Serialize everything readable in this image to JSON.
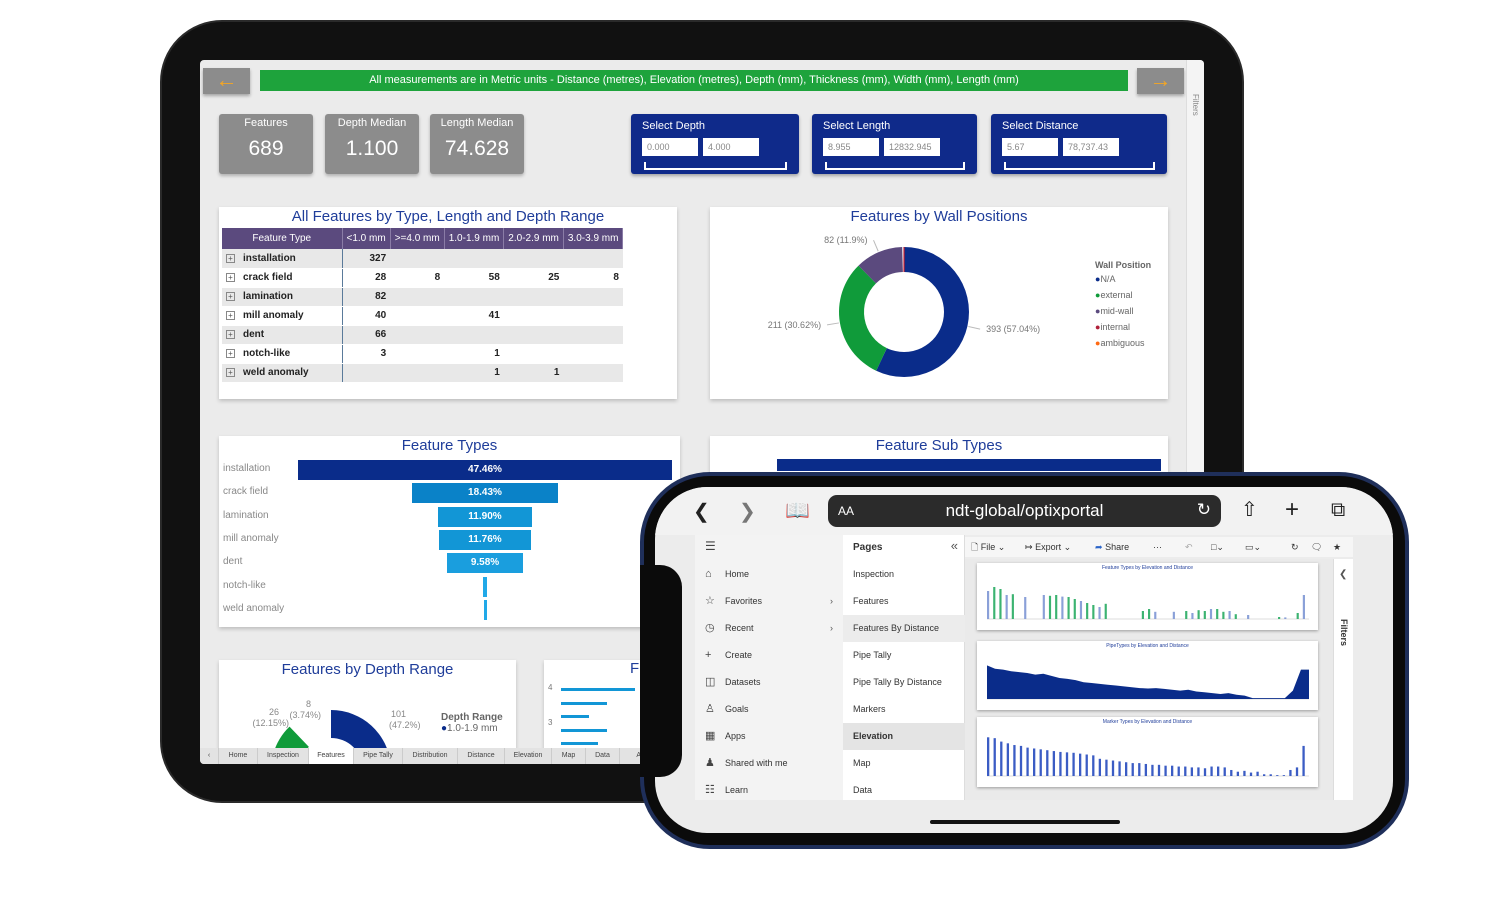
{
  "tablet": {
    "banner": "All measurements are in Metric units - Distance (metres), Elevation (metres), Depth (mm), Thickness (mm), Width (mm), Length (mm)",
    "back_icon": "arrow-left",
    "forward_icon": "arrow-right",
    "accent": "#f5a623",
    "filters_label": "Filters",
    "kpis": [
      {
        "label": "Features",
        "value": "689"
      },
      {
        "label": "Depth Median",
        "value": "1.100"
      },
      {
        "label": "Length Median",
        "value": "74.628"
      }
    ],
    "slicers": [
      {
        "label": "Select Depth",
        "min": "0.000",
        "max": "4.000"
      },
      {
        "label": "Select Length",
        "min": "8.955",
        "max": "12832.945"
      },
      {
        "label": "Select Distance",
        "min": "5.67",
        "max": "78,737.43"
      }
    ],
    "table": {
      "title": "All Features by Type, Length and Depth Range",
      "headers": [
        "Feature Type",
        "<1.0 mm",
        ">=4.0 mm",
        "1.0-1.9 mm",
        "2.0-2.9 mm",
        "3.0-3.9 mm"
      ],
      "rows": [
        [
          "installation",
          "327",
          "",
          "",
          "",
          ""
        ],
        [
          "crack field",
          "28",
          "8",
          "58",
          "25",
          "8"
        ],
        [
          "lamination",
          "82",
          "",
          "",
          "",
          ""
        ],
        [
          "mill anomaly",
          "40",
          "",
          "41",
          "",
          ""
        ],
        [
          "dent",
          "66",
          "",
          "",
          "",
          ""
        ],
        [
          "notch-like",
          "3",
          "",
          "1",
          "",
          ""
        ],
        [
          "weld anomaly",
          "",
          "",
          "1",
          "1",
          ""
        ]
      ]
    },
    "feature_subtypes_title": "Feature Sub Types",
    "small_card": {
      "title": "F",
      "ticks": [
        "4",
        "3"
      ]
    },
    "tabs": [
      "Home",
      "Inspection",
      "Features",
      "Pipe Tally",
      "Distribution",
      "Distance",
      "Elevation",
      "Map",
      "Data",
      "Al"
    ],
    "active_tab": "Features"
  },
  "chart_data": [
    {
      "type": "pie",
      "title": "Features by Wall Positions",
      "legend_title": "Wall Position",
      "legend_position": "right",
      "slices": [
        {
          "name": "N/A",
          "value": 393,
          "label": "393 (57.04%)",
          "pct": 57.04,
          "color": "#0a2c8a"
        },
        {
          "name": "external",
          "value": 211,
          "label": "211 (30.62%)",
          "pct": 30.62,
          "color": "#109b3a"
        },
        {
          "name": "mid-wall",
          "value": 82,
          "label": "82 (11.9%)",
          "pct": 11.9,
          "color": "#5b4a7e"
        },
        {
          "name": "internal",
          "color": "#b0203a"
        },
        {
          "name": "ambiguous",
          "color": "#ff6a13"
        }
      ]
    },
    {
      "type": "bar",
      "title": "Feature Types",
      "orientation": "funnel",
      "categories": [
        "installation",
        "crack field",
        "lamination",
        "mill anomaly",
        "dent",
        "notch-like",
        "weld anomaly"
      ],
      "values": [
        47.46,
        18.43,
        11.9,
        11.76,
        9.58,
        0.58,
        0.29
      ],
      "labels": [
        "47.46%",
        "18.43%",
        "11.90%",
        "11.76%",
        "9.58%",
        "",
        ""
      ],
      "colors": [
        "#0a2c8a",
        "#0a82c8",
        "#1296d6",
        "#1296d6",
        "#1a9ede",
        "#21a9e8",
        "#21a9e8"
      ]
    },
    {
      "type": "pie",
      "title": "Features by Depth Range",
      "legend_title": "Depth Range",
      "legend_entries": [
        "1.0-1.9 mm"
      ],
      "slices": [
        {
          "value": 101,
          "label": "101",
          "pct_label": "(47.2%)",
          "pct": 47.2,
          "color": "#0a2c8a"
        },
        {
          "value": 8,
          "label": "8",
          "pct_label": "(3.74%)",
          "pct": 3.74,
          "color": "#b0203a"
        },
        {
          "color": "#ff6a13"
        },
        {
          "value": 26,
          "label": "26",
          "pct_label": "(12.15%)",
          "pct": 12.15,
          "color": "#109b3a"
        }
      ]
    }
  ],
  "phone": {
    "url": "ndt-global/optixportal",
    "aa": "AA",
    "nav": [
      {
        "label": "Home",
        "icon": "home"
      },
      {
        "label": "Favorites",
        "icon": "star",
        "chev": true
      },
      {
        "label": "Recent",
        "icon": "clock",
        "chev": true
      },
      {
        "label": "Create",
        "icon": "plus"
      },
      {
        "label": "Datasets",
        "icon": "database"
      },
      {
        "label": "Goals",
        "icon": "trophy"
      },
      {
        "label": "Apps",
        "icon": "apps"
      },
      {
        "label": "Shared with me",
        "icon": "shared"
      },
      {
        "label": "Learn",
        "icon": "book"
      }
    ],
    "pages_title": "Pages",
    "pages": [
      "Inspection",
      "Features",
      "Features By Distance",
      "Pipe Tally",
      "Pipe Tally By Distance",
      "Markers",
      "Elevation",
      "Map",
      "Data"
    ],
    "highlighted_page": "Features By Distance",
    "selected_page": "Elevation",
    "toolbar": {
      "file": "File",
      "export": "Export",
      "share": "Share",
      "more": "···"
    },
    "filters_label": "Filters",
    "mini_charts": [
      {
        "title": "Feature Types by Elevation and Distance",
        "type": "bar",
        "color": "#3cb371",
        "values": [
          70,
          80,
          75,
          60,
          62,
          0,
          55,
          0,
          0,
          60,
          58,
          60,
          56,
          55,
          50,
          45,
          40,
          35,
          30,
          38,
          0,
          0,
          0,
          0,
          0,
          20,
          25,
          18,
          0,
          0,
          18,
          0,
          20,
          15,
          22,
          20,
          25,
          25,
          18,
          20,
          12,
          0,
          10,
          0,
          0,
          0,
          0,
          5,
          4,
          0,
          15,
          60
        ]
      },
      {
        "title": "PipeTypes by Elevation and Distance",
        "type": "area",
        "color": "#0a2c8a",
        "values": [
          80,
          72,
          70,
          66,
          64,
          62,
          58,
          60,
          55,
          50,
          48,
          45,
          40,
          38,
          36,
          34,
          32,
          30,
          28,
          26,
          25,
          26,
          24,
          22,
          20,
          22,
          18,
          16,
          14,
          12,
          14,
          10,
          8,
          2,
          2,
          2,
          2,
          2,
          20,
          70
        ]
      },
      {
        "title": "Marker Types by Elevation and Distance",
        "type": "bar",
        "color": "#3b5cc4",
        "values": [
          90,
          88,
          80,
          76,
          72,
          70,
          66,
          64,
          62,
          60,
          58,
          56,
          55,
          54,
          52,
          50,
          48,
          40,
          38,
          36,
          34,
          32,
          30,
          30,
          28,
          26,
          26,
          24,
          24,
          22,
          22,
          20,
          20,
          18,
          22,
          22,
          20,
          14,
          10,
          12,
          8,
          10,
          4,
          4,
          2,
          2,
          14,
          20,
          70
        ]
      }
    ]
  }
}
